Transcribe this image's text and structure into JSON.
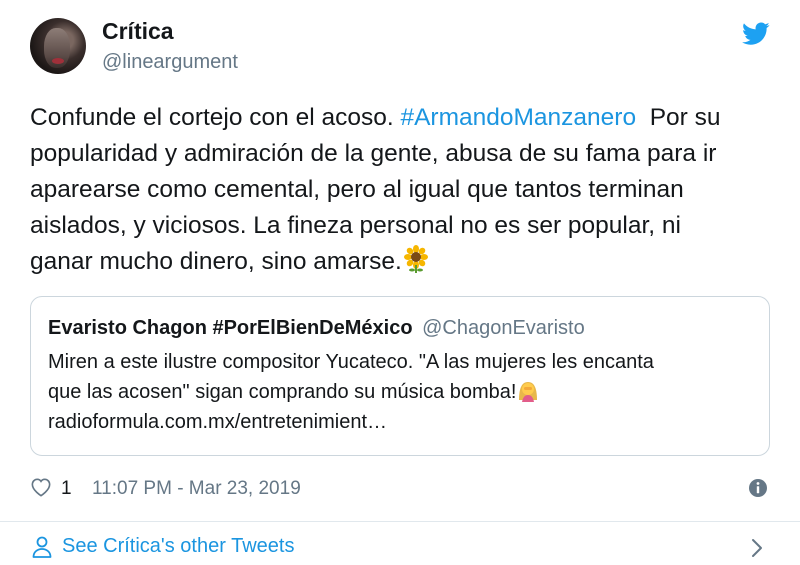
{
  "author": {
    "display_name": "Crítica",
    "handle": "@lineargument"
  },
  "tweet": {
    "text_lines": [
      {
        "before": "Confunde el cortejo con el acoso. ",
        "hashtag": "#ArmandoManzanero",
        "after": "  Por su"
      },
      "popularidad y admiración de la gente, abusa de su fama para ir",
      "aparearse como cemental, pero al igual que tantos terminan",
      "aislados, y viciosos. La fineza personal no es ser popular, ni",
      "ganar mucho dinero, sino amarse."
    ],
    "emoji": "sunflower-icon"
  },
  "quoted": {
    "name": "Evaristo Chagon #PorElBienDeMéxico",
    "handle": "@ChagonEvaristo",
    "lines": [
      "Miren a este ilustre compositor Yucateco. \"A las mujeres les encanta",
      "que las acosen\" sigan comprando su música bomba!",
      "radioformula.com.mx/entretenimient…"
    ],
    "emoji": "woman-facepalming-icon"
  },
  "footer": {
    "like_count": "1",
    "timestamp": "11:07 PM - Mar 23, 2019"
  },
  "see_more": {
    "label": "See Crítica's other Tweets"
  },
  "colors": {
    "link": "#1b95e0",
    "secondary": "#657786",
    "border": "#ccd6dd"
  }
}
